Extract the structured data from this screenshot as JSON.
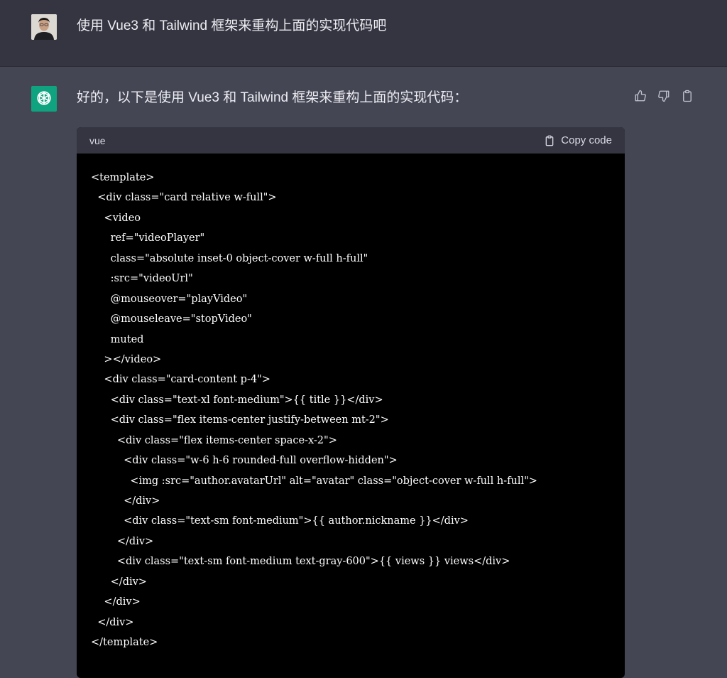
{
  "user_message": {
    "text": "使用 Vue3 和 Tailwind 框架来重构上面的实现代码吧"
  },
  "assistant_message": {
    "text": "好的，以下是使用 Vue3 和 Tailwind 框架来重构上面的实现代码：",
    "actions": {
      "thumbs_up_icon": "thumbs-up-icon",
      "thumbs_down_icon": "thumbs-down-icon",
      "copy_icon": "clipboard-icon"
    }
  },
  "code_block": {
    "language": "vue",
    "copy_label": "Copy code",
    "lines": [
      "<template>",
      "  <div class=\"card relative w-full\">",
      "    <video",
      "      ref=\"videoPlayer\"",
      "      class=\"absolute inset-0 object-cover w-full h-full\"",
      "      :src=\"videoUrl\"",
      "      @mouseover=\"playVideo\"",
      "      @mouseleave=\"stopVideo\"",
      "      muted",
      "    ></video>",
      "    <div class=\"card-content p-4\">",
      "      <div class=\"text-xl font-medium\">{{ title }}</div>",
      "      <div class=\"flex items-center justify-between mt-2\">",
      "        <div class=\"flex items-center space-x-2\">",
      "          <div class=\"w-6 h-6 rounded-full overflow-hidden\">",
      "            <img :src=\"author.avatarUrl\" alt=\"avatar\" class=\"object-cover w-full h-full\">",
      "          </div>",
      "          <div class=\"text-sm font-medium\">{{ author.nickname }}</div>",
      "        </div>",
      "        <div class=\"text-sm font-medium text-gray-600\">{{ views }} views</div>",
      "      </div>",
      "    </div>",
      "  </div>",
      "</template>"
    ]
  },
  "colors": {
    "user_bg": "#343541",
    "assistant_bg": "#444654",
    "bot_avatar": "#10a37f",
    "code_bg": "#000000",
    "code_header_bg": "#343541"
  }
}
